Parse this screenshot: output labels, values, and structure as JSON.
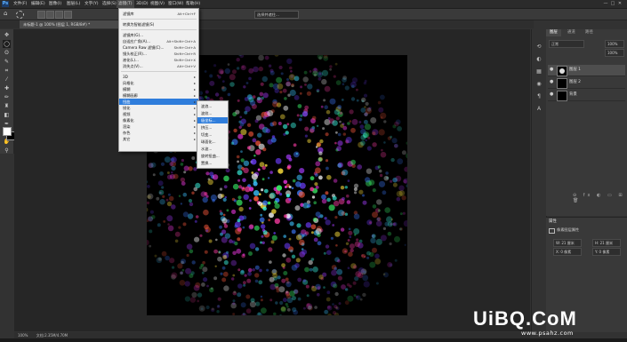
{
  "app": {
    "logo": "Ps"
  },
  "menubar": {
    "items": [
      "文件(F)",
      "编辑(E)",
      "图像(I)",
      "图层(L)",
      "文字(Y)",
      "选择(S)",
      "滤镜(T)",
      "3D(D)",
      "视图(V)",
      "窗口(W)",
      "帮助(H)"
    ],
    "active_index": 6
  },
  "window_controls": [
    "—",
    "□",
    "✕"
  ],
  "options": {
    "mode_value": "正常",
    "select_subject": "选择并遮住..."
  },
  "document": {
    "tab_title": "未标题-1 @ 100% (图层 1, RGB/8#) *"
  },
  "filter_menu": {
    "items": [
      {
        "label": "滤镜库",
        "shortcut": "Alt+Ctrl+F",
        "sep_after": true
      },
      {
        "label": "转换为智能滤镜(S)",
        "shortcut": "",
        "sep_after": true
      },
      {
        "label": "滤镜库(G)...",
        "shortcut": ""
      },
      {
        "label": "自适应广角(A)...",
        "shortcut": "Alt+Shift+Ctrl+A"
      },
      {
        "label": "Camera Raw 滤镜(C)...",
        "shortcut": "Shift+Ctrl+A"
      },
      {
        "label": "镜头校正(R)...",
        "shortcut": "Shift+Ctrl+R"
      },
      {
        "label": "液化(L)...",
        "shortcut": "Shift+Ctrl+X"
      },
      {
        "label": "消失点(V)...",
        "shortcut": "Alt+Ctrl+V",
        "sep_after": true
      },
      {
        "label": "3D",
        "shortcut": "▸"
      },
      {
        "label": "风格化",
        "shortcut": "▸"
      },
      {
        "label": "模糊",
        "shortcut": "▸"
      },
      {
        "label": "模糊画廊",
        "shortcut": "▸"
      },
      {
        "label": "扭曲",
        "shortcut": "▸",
        "highlight": true
      },
      {
        "label": "锐化",
        "shortcut": "▸"
      },
      {
        "label": "视频",
        "shortcut": "▸"
      },
      {
        "label": "像素化",
        "shortcut": "▸"
      },
      {
        "label": "渲染",
        "shortcut": "▸"
      },
      {
        "label": "杂色",
        "shortcut": "▸"
      },
      {
        "label": "其它",
        "shortcut": "▸"
      }
    ]
  },
  "distort_submenu": {
    "items": [
      {
        "label": "波浪..."
      },
      {
        "label": "波纹..."
      },
      {
        "label": "极坐标...",
        "highlight": true
      },
      {
        "label": "挤压..."
      },
      {
        "label": "切变..."
      },
      {
        "label": "球面化..."
      },
      {
        "label": "水波..."
      },
      {
        "label": "旋转扭曲..."
      },
      {
        "label": "置换..."
      }
    ]
  },
  "layers_panel": {
    "tabs": [
      "图层",
      "通道",
      "路径"
    ],
    "blend_mode": "正常",
    "opacity": "100%",
    "fill": "100%",
    "layers": [
      {
        "name": "图层 1",
        "active": true
      },
      {
        "name": "图层 2",
        "active": false
      },
      {
        "name": "背景",
        "active": false
      }
    ]
  },
  "properties_panel": {
    "title": "属性",
    "subtitle": "像素图层属性",
    "w": "W: 21 厘米",
    "h": "H: 21 厘米",
    "x": "X: 0 像素",
    "y": "Y: 0 像素"
  },
  "statusbar": {
    "zoom": "100%",
    "doc": "文档:2.35M/4.70M"
  },
  "watermark": {
    "main": "UiBQ.CoM",
    "sub": "www.psahz.com"
  },
  "colors": {
    "menu_highlight": "#2f7ddb",
    "ui_bg": "#323232",
    "canvas": "#000000"
  }
}
